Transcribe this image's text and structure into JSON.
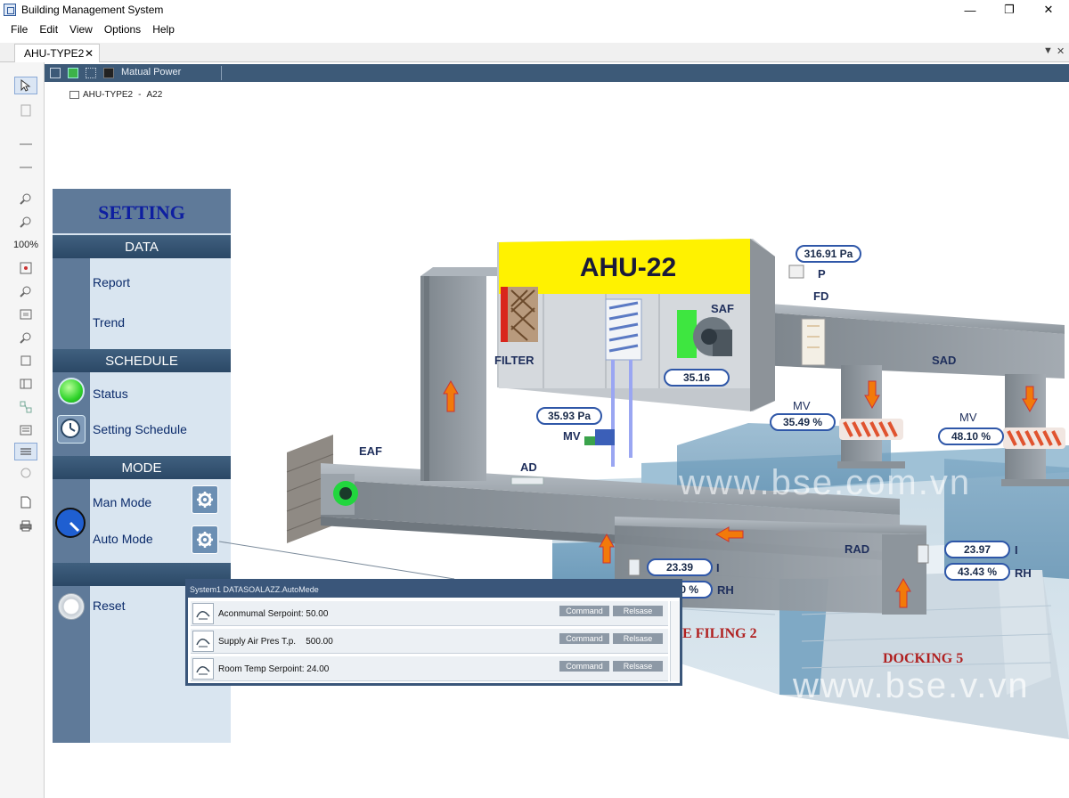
{
  "window": {
    "title": "Building Management System",
    "minimize": "—",
    "maximize": "❐",
    "close": "✕"
  },
  "menu": [
    "File",
    "Edit",
    "View",
    "Options",
    "Help"
  ],
  "tab": {
    "label": "AHU-TYPE2",
    "close": "✕"
  },
  "toolbar": {
    "zoom_label": "100%"
  },
  "ribbon": {
    "label": "Matual Power"
  },
  "breadcrumb": {
    "item": "AHU-TYPE2",
    "separator": "-",
    "sub": "A22"
  },
  "setting_panel": {
    "title": "SETTING",
    "data_header": "DATA",
    "report": "Report",
    "trend": "Trend",
    "schedule_header": "SCHEDULE",
    "status": "Status",
    "setting_schedule": "Setting Schedule",
    "mode_header": "MODE",
    "man_mode": "Man Mode",
    "auto_mode": "Auto Mode",
    "reset": "Reset"
  },
  "popup": {
    "title": "System1 DATASOALAZZ.AutoMede",
    "rows": [
      {
        "label": "Aconmumal Serpoint: 50.00",
        "command": "Command",
        "release": "Relsase"
      },
      {
        "label": "Supply Air Pres T.p.    500.00",
        "command": "Command",
        "release": "Relsase"
      },
      {
        "label": "Room Temp Serpoint: 24.00",
        "command": "Command",
        "release": "Relsase"
      }
    ]
  },
  "diagram": {
    "ahu_name": "AHU-22",
    "filter": "FILTER",
    "saf": "SAF",
    "saf_value": "35.16",
    "eaf": "EAF",
    "ad": "AD",
    "mv": "MV",
    "mv_pressure": "35.93 Pa",
    "pressure_value": "316.91 Pa",
    "p": "P",
    "fd": "FD",
    "sad": "SAD",
    "mv1_label": "MV",
    "mv1_value": "35.49 %",
    "mv2_label": "MV",
    "mv2_value": "48.10 %",
    "rad": "RAD",
    "room1_temp": "23.39",
    "room1_temp_unit": "I",
    "room1_rh": "0 %",
    "room1_rh_unit": "RH",
    "room2_temp": "23.97",
    "room2_temp_unit": "I",
    "room2_rh": "43.43 %",
    "room2_rh_unit": "RH",
    "room1_name": "E FILING 2",
    "room2_name": "DOCKING 5",
    "watermark1": "www.bse.com.vn",
    "watermark2": "www.bse.v.vn"
  },
  "colors": {
    "ribbon": "#3d5a78",
    "panel": "#d9e5f0",
    "ahu_header": "#fff200",
    "duct": "#9aa1a8",
    "value_border": "#2f57a8"
  }
}
